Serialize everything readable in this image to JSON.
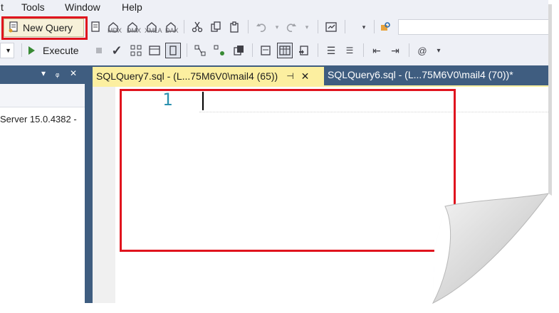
{
  "menubar": {
    "items": [
      "t",
      "Tools",
      "Window",
      "Help"
    ]
  },
  "toolbar1": {
    "new_query_label": "New Query",
    "icons": [
      "new-document-icon",
      "mdx-query-icon",
      "dmx-query-icon",
      "xmla-query-icon",
      "dax-query-icon",
      "cut-icon",
      "copy-icon",
      "paste-icon",
      "undo-icon",
      "redo-icon",
      "solution-explorer-icon",
      "find-icon"
    ],
    "icon_captions": [
      "MDX",
      "DMX",
      "XMLA",
      "DAX"
    ],
    "search_value": ""
  },
  "toolbar2": {
    "execute_label": "Execute",
    "stop_icon": "stop-icon",
    "parse_icon": "checkmark-icon"
  },
  "object_explorer": {
    "server_text": "Server 15.0.4382 -",
    "controls": [
      "▾",
      "ᵩ",
      "✕"
    ]
  },
  "tabs": [
    {
      "title": "SQLQuery7.sql - (L...75M6V0\\mail4 (65))",
      "active": true
    },
    {
      "title": "SQLQuery6.sql - (L...75M6V0\\mail4 (70))*",
      "active": false
    }
  ],
  "editor": {
    "line_numbers": [
      "1"
    ],
    "content": ""
  },
  "colors": {
    "chrome_background": "#eef0f6",
    "tab_well": "#3f5d80",
    "active_tab": "#fcefa0",
    "highlight_red": "#e0141e",
    "line_number": "#2b91af"
  }
}
